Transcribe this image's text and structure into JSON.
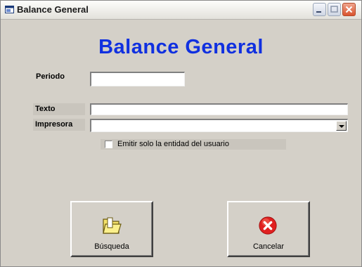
{
  "window": {
    "title": "Balance General"
  },
  "form": {
    "heading": "Balance General",
    "periodo_label": "Periodo",
    "periodo_value": "",
    "texto_label": "Texto",
    "texto_value": "",
    "impresora_label": "Impresora",
    "impresora_value": "",
    "checkbox_label": "Emitir solo la entidad del usuario",
    "checkbox_checked": false
  },
  "buttons": {
    "search_label": "Búsqueda",
    "cancel_label": "Cancelar"
  },
  "colors": {
    "heading": "#1030e0",
    "window_bg": "#d4d0c8",
    "cancel_icon": "#e02020"
  },
  "icons": {
    "app": "window-app-icon",
    "search": "search-folder-icon",
    "cancel": "cancel-x-icon"
  }
}
